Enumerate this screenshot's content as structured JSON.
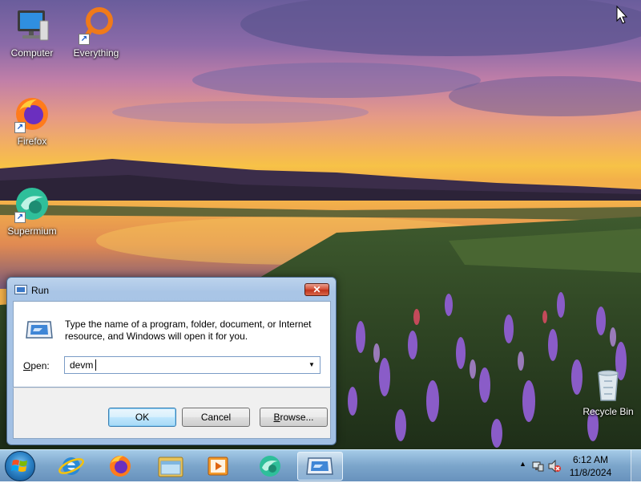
{
  "desktop": {
    "icons": [
      {
        "label": "Computer"
      },
      {
        "label": "Everything"
      },
      {
        "label": "Firefox"
      },
      {
        "label": "Supermium"
      },
      {
        "label": "Recycle Bin"
      }
    ]
  },
  "run_dialog": {
    "title": "Run",
    "close_glyph": "✕",
    "description": "Type the name of a program, folder, document, or Internet resource, and Windows will open it for you.",
    "open_label": "Open:",
    "open_value": "devm",
    "buttons": {
      "ok": "OK",
      "cancel": "Cancel",
      "browse": "Browse..."
    }
  },
  "taskbar": {
    "pinned": [
      {
        "name": "internet-explorer-icon"
      },
      {
        "name": "firefox-icon"
      },
      {
        "name": "file-explorer-icon"
      },
      {
        "name": "media-player-icon"
      },
      {
        "name": "supermium-icon"
      },
      {
        "name": "run-icon",
        "active": true
      }
    ],
    "clock": {
      "time": "6:12 AM",
      "date": "11/8/2024"
    }
  },
  "colors": {
    "accent": "#3c7fb1",
    "close_red": "#c0341c"
  }
}
